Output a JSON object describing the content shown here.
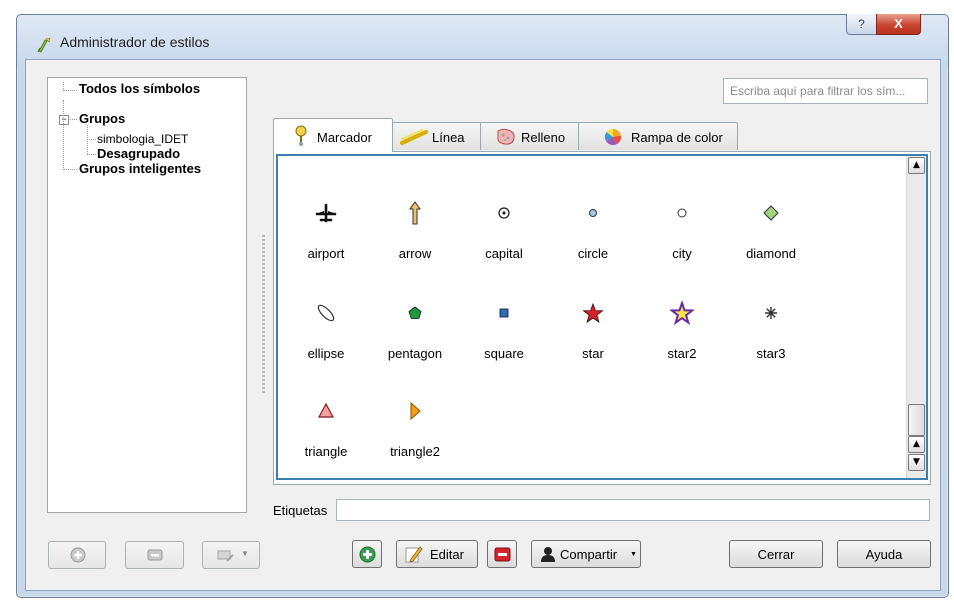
{
  "window": {
    "title": "Administrador de estilos",
    "help_glyph": "?",
    "close_glyph": "X"
  },
  "tree": {
    "items": [
      {
        "label": "Todos los símbolos",
        "bold": true
      },
      {
        "label": "Grupos",
        "bold": true,
        "expander": "−"
      },
      {
        "label": "simbologia_IDET",
        "bold": false
      },
      {
        "label": "Desagrupado",
        "bold": true
      },
      {
        "label": "Grupos inteligentes",
        "bold": true
      }
    ]
  },
  "filter": {
    "placeholder": "Escriba aquí para filtrar los sím..."
  },
  "tabs": [
    {
      "label": "Marcador",
      "active": true,
      "icon": "marker-pin-icon"
    },
    {
      "label": "Línea",
      "active": false,
      "icon": "line-icon"
    },
    {
      "label": "Relleno",
      "active": false,
      "icon": "fill-icon"
    },
    {
      "label": "Rampa de color",
      "active": false,
      "icon": "color-ramp-icon"
    }
  ],
  "symbols": [
    {
      "name": "airport",
      "icon": "airport-icon"
    },
    {
      "name": "arrow",
      "icon": "arrow-icon"
    },
    {
      "name": "capital",
      "icon": "capital-icon"
    },
    {
      "name": "circle",
      "icon": "circle-icon"
    },
    {
      "name": "city",
      "icon": "city-icon"
    },
    {
      "name": "diamond",
      "icon": "diamond-icon"
    },
    {
      "name": "ellipse",
      "icon": "ellipse-icon"
    },
    {
      "name": "pentagon",
      "icon": "pentagon-icon"
    },
    {
      "name": "square",
      "icon": "square-icon"
    },
    {
      "name": "star",
      "icon": "star-icon"
    },
    {
      "name": "star2",
      "icon": "star2-icon"
    },
    {
      "name": "star3",
      "icon": "star3-icon"
    },
    {
      "name": "triangle",
      "icon": "triangle-icon"
    },
    {
      "name": "triangle2",
      "icon": "triangle2-icon"
    }
  ],
  "tags": {
    "label": "Etiquetas",
    "value": ""
  },
  "buttons": {
    "edit": "Editar",
    "share": "Compartir",
    "close": "Cerrar",
    "help": "Ayuda"
  },
  "colors": {
    "accent_border": "#3c7fb1",
    "window_frame": "#c8d8ea",
    "close_button": "#c9452f"
  }
}
